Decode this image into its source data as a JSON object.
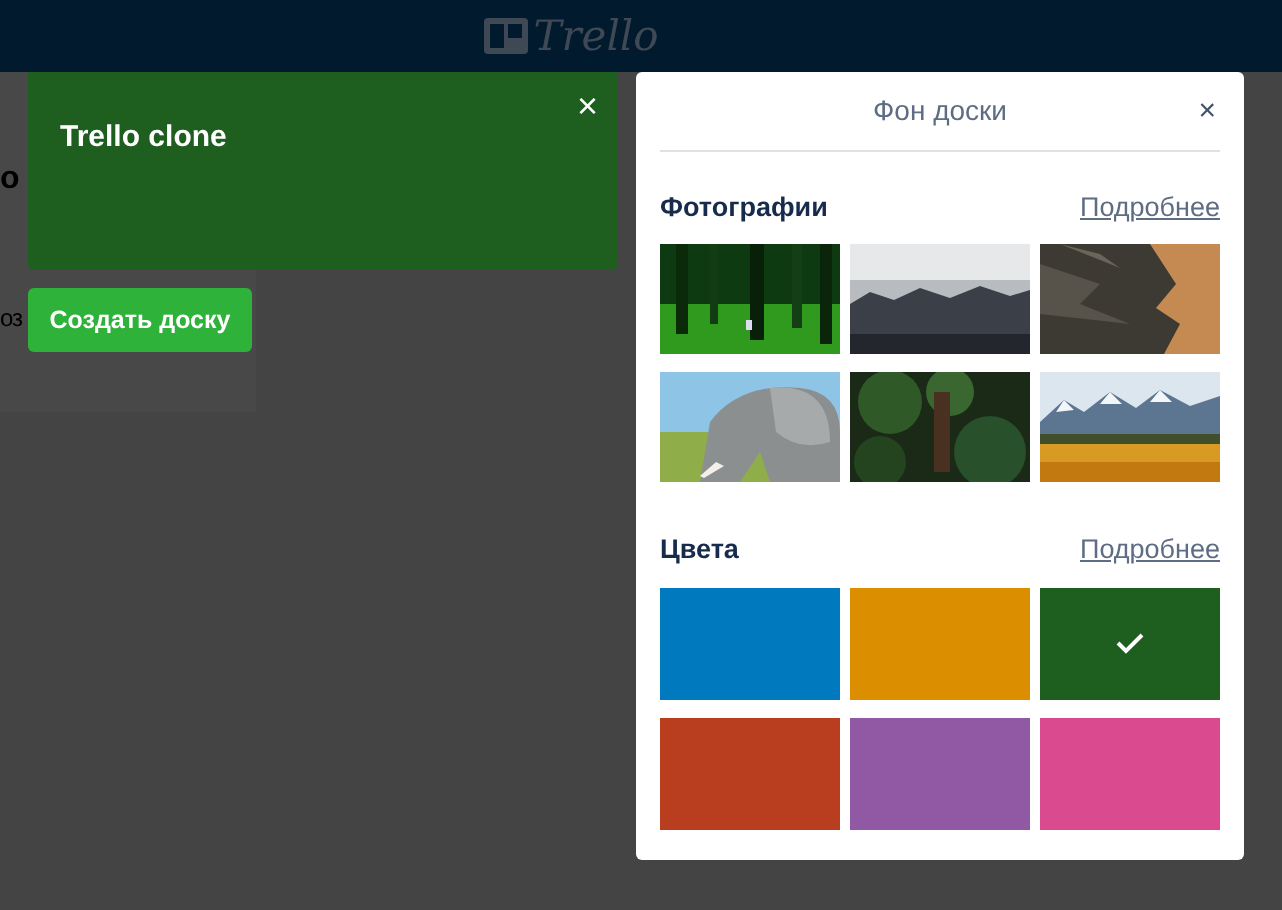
{
  "header": {
    "logo": "Trello"
  },
  "background": {
    "heading": "о",
    "text": "оз"
  },
  "new_board": {
    "title": "Trello clone",
    "close": "×",
    "create_button": "Создать доску"
  },
  "popover": {
    "title": "Фон доски",
    "close": "×",
    "photos": {
      "heading": "Фотографии",
      "more": "Подробнее"
    },
    "colors": {
      "heading": "Цвета",
      "more": "Подробнее",
      "items": [
        {
          "color": "#0079bf",
          "selected": false
        },
        {
          "color": "#db8f00",
          "selected": false
        },
        {
          "color": "#1e5e1e",
          "selected": true
        },
        {
          "color": "#b93e20",
          "selected": false
        },
        {
          "color": "#9158a3",
          "selected": false
        },
        {
          "color": "#da4a8f",
          "selected": false
        }
      ]
    }
  }
}
